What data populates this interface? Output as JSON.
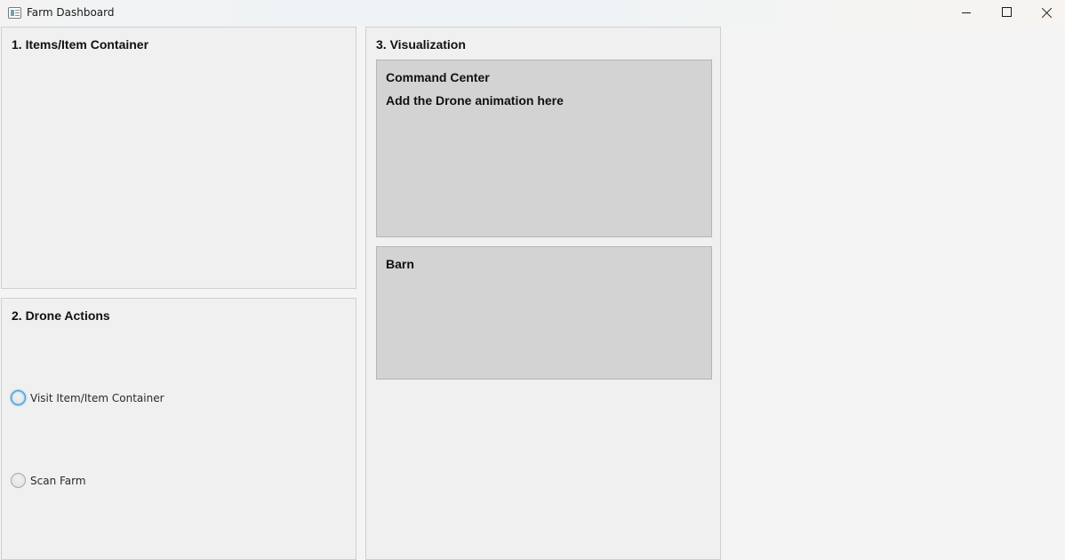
{
  "window": {
    "title": "Farm Dashboard"
  },
  "panels": {
    "items": {
      "title": "1. Items/Item Container"
    },
    "drone_actions": {
      "title": "2. Drone Actions",
      "options": [
        {
          "label": "Visit Item/Item Container",
          "selected": false,
          "focused": true
        },
        {
          "label": "Scan Farm",
          "selected": false,
          "focused": false
        }
      ]
    },
    "visualization": {
      "title": "3. Visualization",
      "command_center": {
        "title": "Command Center",
        "subtitle": "Add the Drone animation here"
      },
      "barn": {
        "title": "Barn"
      }
    }
  },
  "colors": {
    "panel_bg": "#f0f0f0",
    "subbox_bg": "#d3d3d3",
    "focus_accent": "#3a9bd9"
  },
  "icons": {
    "app": "app-window-icon",
    "minimize": "minimize-icon",
    "maximize": "maximize-icon",
    "close": "close-icon"
  }
}
